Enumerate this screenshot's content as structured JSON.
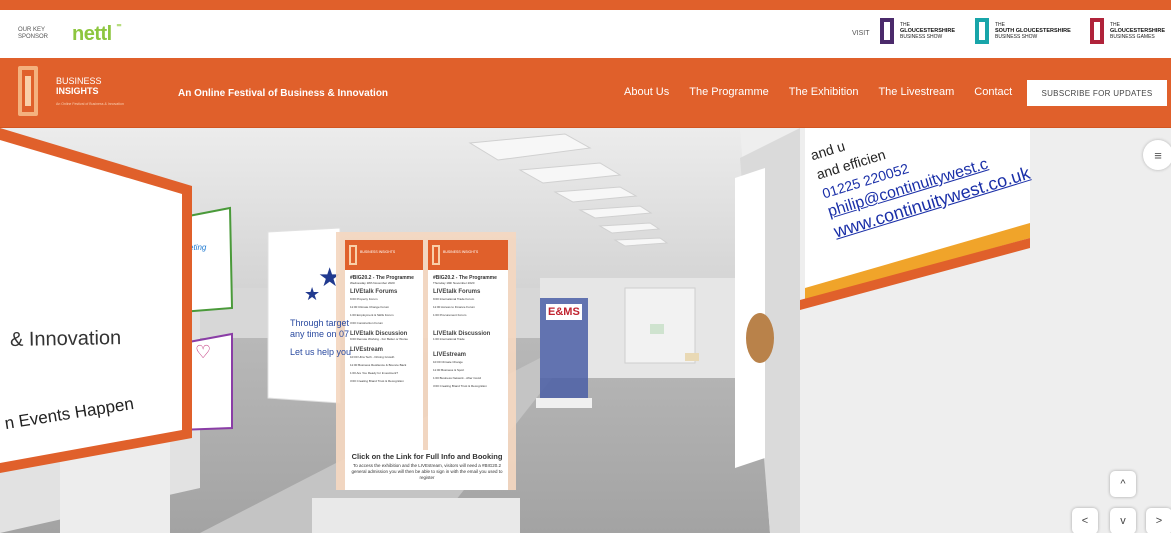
{
  "sponsor_bar": {
    "key_sponsor_label": "OUR KEY SPONSOR",
    "sponsor_name": "nettl",
    "visit_label": "VISIT",
    "shows": [
      {
        "the": "THE",
        "name": "GLOUCESTERSHIRE",
        "type": "BUSINESS SHOW",
        "color": "#4b2a6b"
      },
      {
        "the": "THE",
        "name": "SOUTH GLOUCESTERSHIRE",
        "type": "BUSINESS SHOW",
        "color": "#18a5a9"
      },
      {
        "the": "THE",
        "name": "GLOUCESTERSHIRE",
        "type": "BUSINESS GAMES",
        "color": "#b0233a"
      }
    ]
  },
  "header": {
    "brand_line1": "BUSINESS",
    "brand_line2": "INSIGHTS",
    "brand_sub": "An Online Festival of Business & Innovation",
    "tagline": "An Online Festival of Business & Innovation",
    "nav": [
      "About Us",
      "The Programme",
      "The Exhibition",
      "The Livestream",
      "Contact"
    ],
    "subscribe_label": "SUBSCRIBE FOR UPDATES"
  },
  "scene": {
    "left_board": {
      "line1": "& Innovation",
      "line2": "n Events Happen"
    },
    "white_board": {
      "line1": "Through target",
      "line2": "any time on 07",
      "line3": "Let us help you"
    },
    "right_board": {
      "l1": "and u",
      "l2": "and efficien",
      "l3": "01225 220052",
      "l4": "philip@continuitywest.c",
      "l5": "www.continuitywest.co.uk"
    },
    "programme": {
      "brand1": "BUSINESS INSIGHTS",
      "brand2": "BUSINESS INSIGHTS",
      "col1_title": "#BIG20.2 - The Programme",
      "col1_date": "Wednesday 18th November 2020",
      "col2_title": "#BIG20.2 - The Programme",
      "col2_date": "Thursday 19th November 2020",
      "col1_h1": "LIVEtalk Forums",
      "col1_items1": [
        "9:00  Property Forum",
        "11:00  Climate Change Forum",
        "1:00  Employment & Skills Forum",
        "3:00  Construction Forum"
      ],
      "col1_h2": "LIVEtalk Discussion",
      "col1_items2": [
        "9:00  Remote Working - For Better or Worse"
      ],
      "col1_h3": "LIVEstream",
      "col1_items3": [
        "10:00  Ultra Tech - Driving Growth",
        "11:00  Business Resilience & Bounce Back",
        "1:00  Are You Ready for Investment?",
        "3:00  Creating Brand Trust & Recognition"
      ],
      "col2_h1": "LIVEtalk Forums",
      "col2_items1": [
        "9:00  International Trade Forum",
        "11:00  Access to Finance Forum",
        "1:00  Procurement Forum"
      ],
      "col2_h2": "LIVEtalk Discussion",
      "col2_items2": [
        "1:00  International Trade"
      ],
      "col2_h3": "LIVEstream",
      "col2_items3": [
        "10:00  Climate Change",
        "11:00  Business & Sport",
        "1:00  Business Network - After Covid",
        "3:00  Creating Brand Trust & Recognition"
      ],
      "footer_title": "Click on the Link for Full Info and Booking",
      "footer_text": "To access the exhibition and the LIVEstream, visitors will need a #BIG20.2 general admission you will then be able to sign in with the email you used to register"
    },
    "exhibitor_badge": "E&MS",
    "menu_icon": "hamburger-icon",
    "arrows": {
      "up": "^",
      "left": "<",
      "down": "v",
      "right": ">"
    }
  }
}
